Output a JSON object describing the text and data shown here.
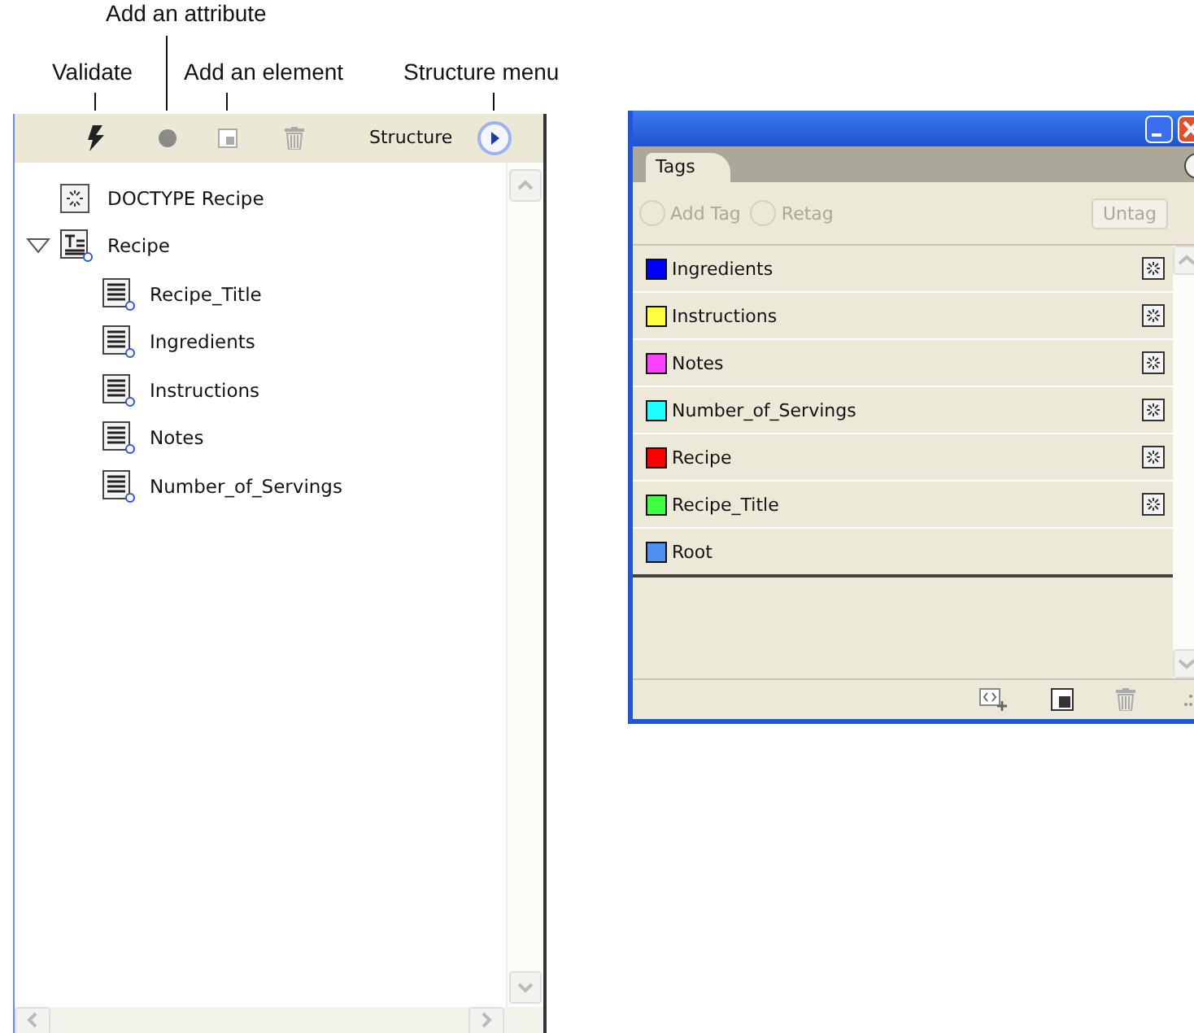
{
  "callouts": [
    "Validate",
    "Add an attribute",
    "Add an element",
    "Structure menu"
  ],
  "structure": {
    "title": "Structure",
    "doctype": "DOCTYPE Recipe",
    "tree": [
      {
        "label": "Recipe",
        "expanded": true,
        "children": [
          {
            "label": "Recipe_Title"
          },
          {
            "label": "Ingredients"
          },
          {
            "label": "Instructions"
          },
          {
            "label": "Notes"
          },
          {
            "label": "Number_of_Servings"
          }
        ]
      }
    ]
  },
  "tags_panel": {
    "tab": "Tags",
    "options": [
      {
        "label": "Add Tag",
        "disabled": true
      },
      {
        "label": "Retag",
        "disabled": true
      }
    ],
    "untag": {
      "label": "Untag",
      "disabled": true
    },
    "tags": [
      {
        "name": "Ingredients",
        "color": "#0000ff",
        "in_use": true
      },
      {
        "name": "Instructions",
        "color": "#ffff40",
        "in_use": true
      },
      {
        "name": "Notes",
        "color": "#ff40ff",
        "in_use": true
      },
      {
        "name": "Number_of_Servings",
        "color": "#20ffff",
        "in_use": true
      },
      {
        "name": "Recipe",
        "color": "#ff0000",
        "in_use": true
      },
      {
        "name": "Recipe_Title",
        "color": "#40ff40",
        "in_use": true
      },
      {
        "name": "Root",
        "color": "#4f8ff0",
        "in_use": false
      }
    ]
  }
}
